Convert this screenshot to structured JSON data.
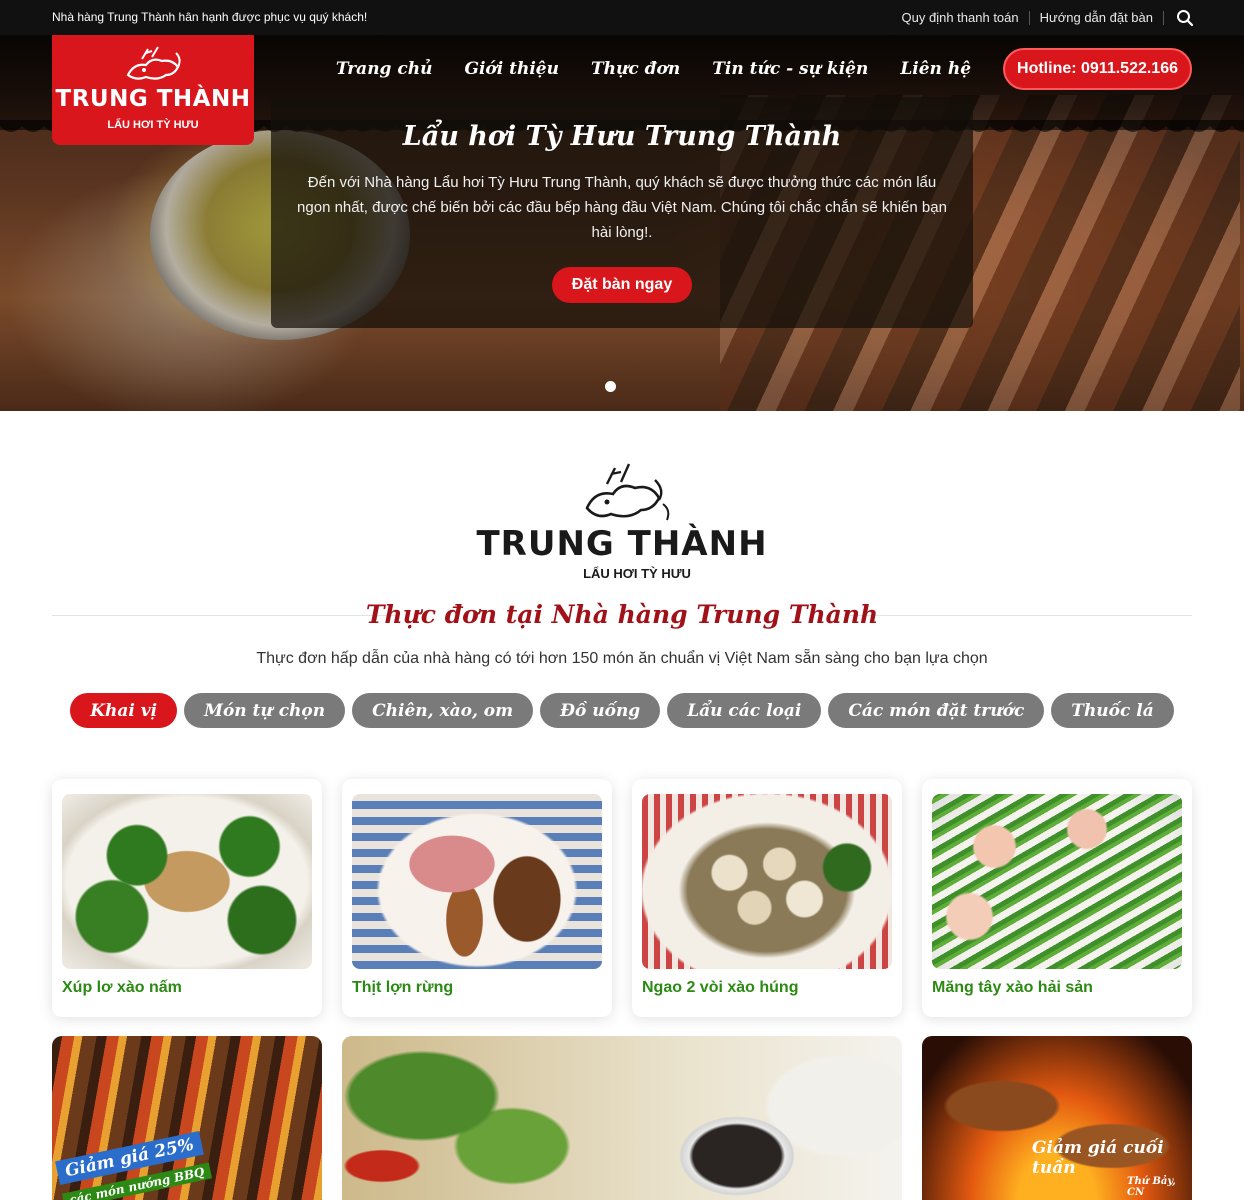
{
  "topbar": {
    "welcome": "Nhà hàng Trung Thành hân hạnh được phục vụ quý khách!",
    "links": [
      "Quy định thanh toán",
      "Hướng dẫn đặt bàn"
    ]
  },
  "logo": {
    "name": "TRUNG THÀNH",
    "tagline": "LẨU HƠI TỲ HƯU"
  },
  "nav": {
    "items": [
      "Trang chủ",
      "Giới thiệu",
      "Thực đơn",
      "Tin tức - sự kiện",
      "Liên hệ"
    ],
    "hotline": "Hotline: 0911.522.166"
  },
  "hero": {
    "title": "Lẩu hơi Tỳ Hưu Trung Thành",
    "description": "Đến với Nhà hàng Lẩu hơi Tỳ Hưu Trung Thành, quý khách sẽ được thưởng thức các món lẩu ngon nhất, được chế biến bởi các đầu bếp hàng đầu Việt Nam. Chúng tôi chắc chắn sẽ khiến bạn hài lòng!.",
    "cta": "Đặt bàn ngay"
  },
  "menu": {
    "brand_name": "TRUNG THÀNH",
    "brand_tagline": "LẨU HƠI TỲ HƯU",
    "title": "Thực đơn tại Nhà hàng Trung Thành",
    "subtitle": "Thực đơn hấp dẫn của nhà hàng có tới hơn 150 món ăn chuẩn vị Việt Nam sẵn sàng cho bạn lựa chọn",
    "tabs": [
      "Khai vị",
      "Món tự chọn",
      "Chiên, xào, om",
      "Đồ uống",
      "Lẩu các loại",
      "Các món đặt trước",
      "Thuốc lá"
    ],
    "items": [
      "Xúp lơ xào nấm",
      "Thịt lợn rừng",
      "Ngao 2 vòi xào húng",
      "Măng tây xào hải sản"
    ]
  },
  "promos": {
    "left_badge": "Giảm giá 25%",
    "left_sub": "các món nướng BBQ",
    "right_badge": "Giảm giá cuối tuần",
    "right_sub": "Thứ Bảy, CN"
  },
  "colors": {
    "brand_red": "#d8161b",
    "title_red": "#a11118",
    "item_green": "#2c8a14",
    "tab_gray": "#7a7a7a"
  }
}
